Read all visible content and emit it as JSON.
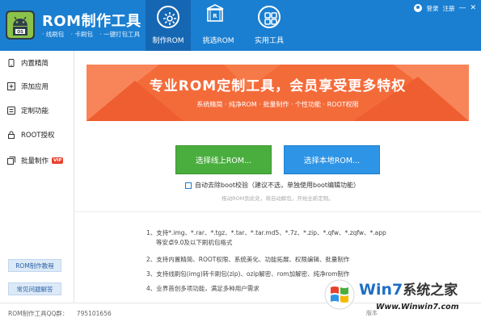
{
  "header": {
    "app_title": "ROM制作工具",
    "subtitle_items": [
      "· 线刷包",
      "· 卡刷包",
      "· 一键打包工具"
    ],
    "tabs": [
      {
        "label": "制作ROM",
        "icon": "gear-icon",
        "active": true
      },
      {
        "label": "挑选ROM",
        "icon": "rom-chip-icon",
        "active": false
      },
      {
        "label": "实用工具",
        "icon": "grid-icon",
        "active": false
      }
    ],
    "login": "登录",
    "register": "注册",
    "win_min": "—",
    "win_close": "✕"
  },
  "sidebar": {
    "items": [
      {
        "label": "内置精简",
        "icon": "phone-icon"
      },
      {
        "label": "添加应用",
        "icon": "plus-square-icon"
      },
      {
        "label": "定制功能",
        "icon": "settings-icon"
      },
      {
        "label": "ROOT授权",
        "icon": "lock-icon"
      },
      {
        "label": "批量制作",
        "icon": "layers-icon",
        "badge": "VIP"
      }
    ],
    "tutorial_button": "ROM制作教程",
    "faq_button": "常见问题解答"
  },
  "banner": {
    "title": "专业ROM定制工具，会员享受更多特权",
    "subtitle": "系统精简 · 纯净ROM · 批量制作 · 个性功能 · ROOT权限",
    "color": "#f46b3a"
  },
  "actions": {
    "online_button": "选择线上ROM...",
    "local_button": "选择本地ROM...",
    "checkbox_label": "自动去除boot校验（建议不选，单独使用boot编辑功能）",
    "checkbox_checked": false,
    "drag_hint": "拖动ROM到此处，将自动解包，开始全新定制。"
  },
  "features": [
    "1、支持*.img、*.rar、*.tgz、*.tar、*.tar.md5、*.7z、*.zip、*.qfw、*.zqfw、*.app",
    "等安卓9.0及以下刷机包格式",
    "2、支持内置精简、ROOT权限、系统美化、功能拓展、权限编辑、批量制作",
    "3、支持线刷包(img)转卡刷包(zip)、ozip解密、rom加解密、纯净rom制作",
    "4、业界首创多项功能，满足多种用户需求"
  ],
  "footer": {
    "qq_label": "ROM制作工具QQ群：",
    "qq_number": "795101656",
    "version": "版本"
  },
  "watermark": {
    "brand": "Win7",
    "brand_suffix": "系统之家",
    "url": "Www.Winwin7.com"
  },
  "colors": {
    "header_blue": "#1a7fd1",
    "online_green": "#4aae3f",
    "local_blue": "#2e94e6",
    "vip_red": "#e8402c"
  }
}
